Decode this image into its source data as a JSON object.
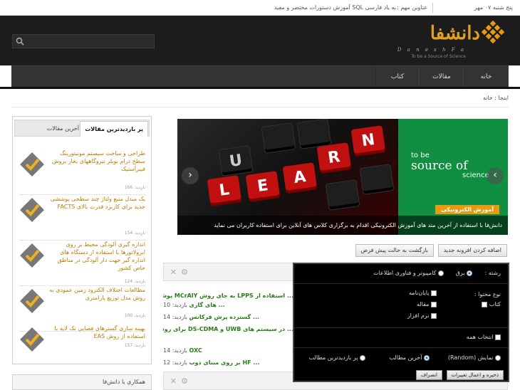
{
  "topbar": {
    "date": "پنج شنبه   ۰۷   مهر",
    "headline_label": "عناوین مهم :",
    "headline_text": "به یاد فارسی SQL آموزش دستورات مختصر و مفید"
  },
  "logo": {
    "brand": "دانشفا",
    "latin": "D a n e s h F a",
    "slogan": "To be a Source of Science"
  },
  "search": {
    "placeholder": ""
  },
  "nav": {
    "items": [
      "خانه",
      "مقالات",
      "کتاب"
    ]
  },
  "breadcrumb": "اینجا : خانه",
  "slider": {
    "keys": [
      "U",
      "L",
      "E",
      "A",
      "R",
      "N"
    ],
    "tagline_1": "to be",
    "tagline_2": "source of",
    "tagline_3": "science",
    "category": "آموزش الکترونیکی",
    "caption": "دانش‌فا با استفاده از آخرین متد های آموزش الکترونیکی اقدام به برگزاری کلاس های آنلاین برای استفاده کاربران می نماید",
    "prev_arrow": "‹",
    "next_arrow": "›"
  },
  "actions": {
    "add_new": "اضافه کردن افزونه جدید",
    "reset": "بازگشت به حالت پیش فرض"
  },
  "content_lines": [
    {
      "main": "... استفاده از LPPS به جای روش MCrAlY پوشش سطح",
      "tail": ""
    },
    {
      "main": "... های گازی",
      "tail": "بازدید: 10"
    },
    {
      "main": "... گسترده پرش فرکانس",
      "tail": "بازدید: 14"
    },
    {
      "main": "... در سیستم های UWB و DS-CDMA برای روش RAKE",
      "tail": ""
    },
    {
      "main": "OXC",
      "tail": "بازدید: 14"
    },
    {
      "main": "... HF بر روی مبنای ذوب",
      "tail": "بازدید: 12"
    }
  ],
  "sidebar": {
    "tab_active": "پر بازدیدترین مقالات",
    "tab_inactive": "آخرین مقالات",
    "posts": [
      {
        "title": "طراحی و ساخت سیستم مونیتورینگ سطح درام بویلر نیروگاههای بخار بروش فیبرآستیک",
        "views": "بازدید: 166"
      },
      {
        "title": "یک مبدل منبع ولتاژ چند سطحی پوششی جدید برای کاربرد قدرت بالای FACTS",
        "views": "بازدید: 154"
      },
      {
        "title": "اندازه گیری آلودگی محیط بر روی ایزولاتورها با استفاده از دستگاه های اندازه گیر جهت دار آلودگی در مناطق خاص کشور",
        "views": "بازدید: 124"
      },
      {
        "title": "مطالعات اختلاف الکترود زمین عمودی به روش مدل توزیع پارامتری",
        "views": "بازدید: 100"
      },
      {
        "title": "بهینه سازی گسترهای فضایی تک لایه با استفاده از روش EAS",
        "views": "بازدید: 157"
      }
    ]
  },
  "cowork_title": "همکاری با دانش‌فا",
  "popup": {
    "category_label": "رشته :",
    "category_options": [
      "برق",
      "کامپیوتر و فناوری اطلاعات"
    ],
    "category_selected": 0,
    "content_type_label": "نوع محتوا :",
    "types": [
      "کتاب",
      "مقاله",
      "پایان‌نامه",
      "نرم افزار"
    ],
    "select_all": "انتخاب همه",
    "order_options": [
      "نمایش (Random)",
      "آخرین مطالب",
      "پر بازدیدترین مطالب"
    ],
    "order_selected": 1,
    "save": "ذخیره و اعمال تغییرات",
    "cancel": "انصراف"
  },
  "colors": {
    "accent": "#e69a10",
    "header_bg": "#1c1c1c",
    "nav_bg": "#333333",
    "slider_green": "#0f8f3f",
    "key_red": "#c01010"
  }
}
